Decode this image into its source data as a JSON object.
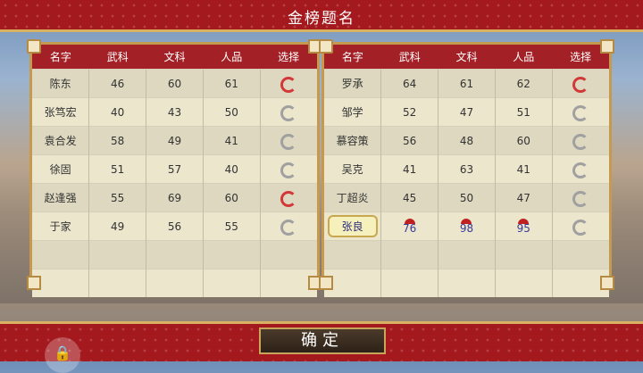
{
  "title": "金榜题名",
  "confirm_label": "确定",
  "headers": [
    "名字",
    "武科",
    "文科",
    "人品",
    "选择"
  ],
  "left_rows": [
    {
      "name": "陈东",
      "wu": "46",
      "wen": "60",
      "ren": "61",
      "sel": "red"
    },
    {
      "name": "张笃宏",
      "wu": "40",
      "wen": "43",
      "ren": "50",
      "sel": "grey"
    },
    {
      "name": "袁合发",
      "wu": "58",
      "wen": "49",
      "ren": "41",
      "sel": "grey"
    },
    {
      "name": "徐固",
      "wu": "51",
      "wen": "57",
      "ren": "40",
      "sel": "grey"
    },
    {
      "name": "赵逢强",
      "wu": "55",
      "wen": "69",
      "ren": "60",
      "sel": "red"
    },
    {
      "name": "于家",
      "wu": "49",
      "wen": "56",
      "ren": "55",
      "sel": "grey"
    }
  ],
  "right_rows": [
    {
      "name": "罗承",
      "wu": "64",
      "wen": "61",
      "ren": "62",
      "sel": "red"
    },
    {
      "name": "邹学",
      "wu": "52",
      "wen": "47",
      "ren": "51",
      "sel": "grey"
    },
    {
      "name": "慕容策",
      "wu": "56",
      "wen": "48",
      "ren": "60",
      "sel": "grey"
    },
    {
      "name": "吴克",
      "wu": "41",
      "wen": "63",
      "ren": "41",
      "sel": "grey"
    },
    {
      "name": "丁超炎",
      "wu": "45",
      "wen": "50",
      "ren": "47",
      "sel": "grey"
    }
  ],
  "selected_row": {
    "name": "张良",
    "wu": "76",
    "wen": "98",
    "ren": "95",
    "sel": "grey"
  }
}
